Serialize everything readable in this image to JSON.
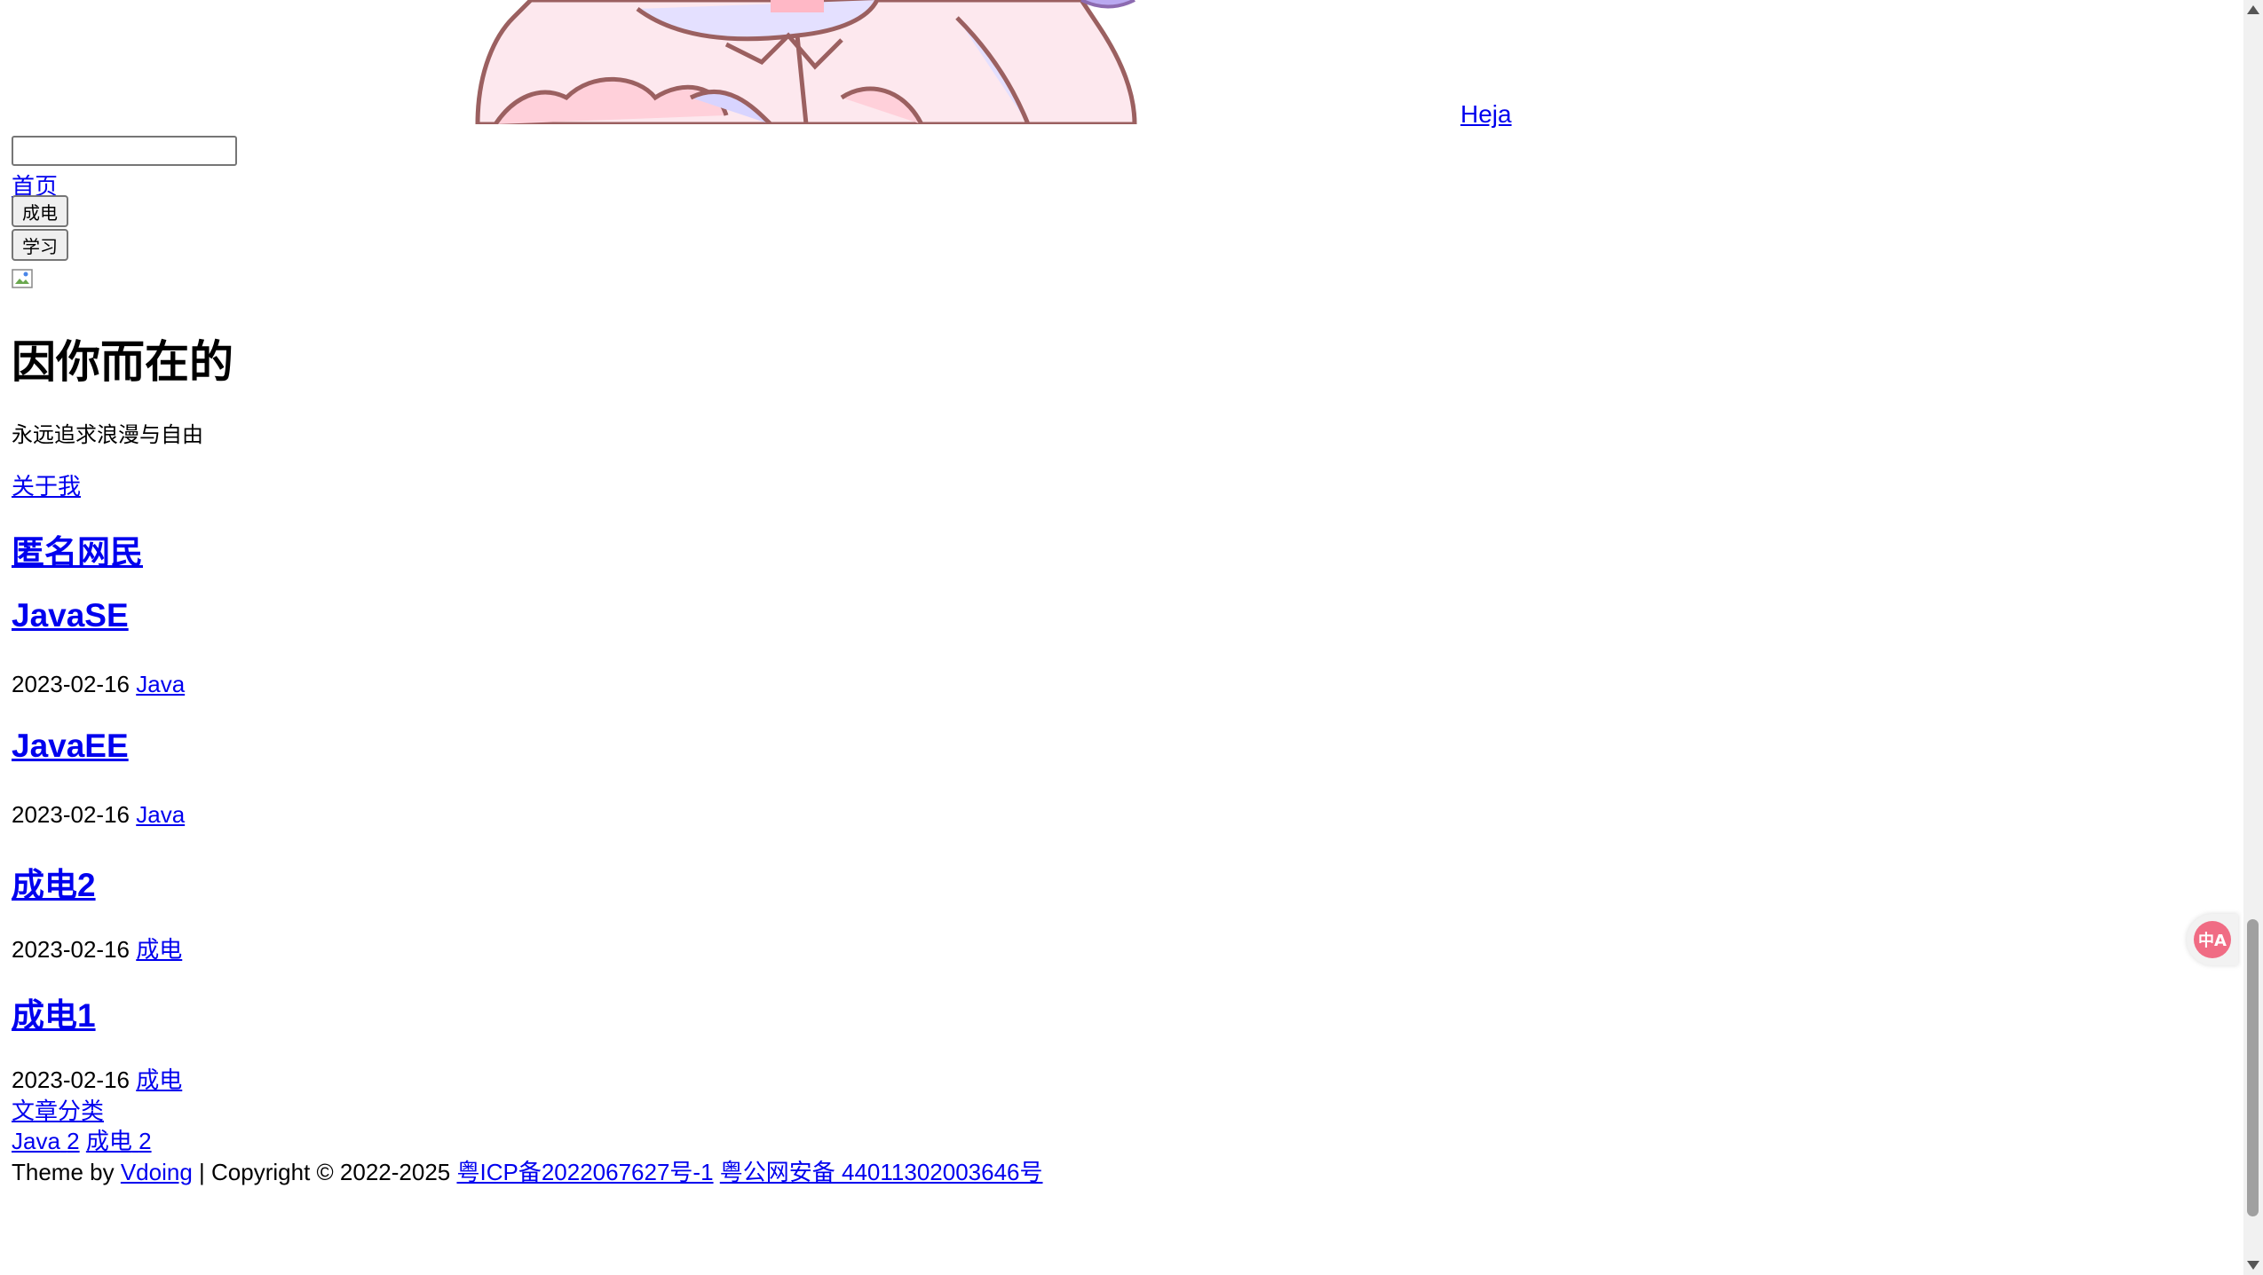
{
  "header": {
    "logo_text": " Heja",
    "search_placeholder": ""
  },
  "nav": {
    "home": "首页",
    "dropdowns": [
      "成电",
      "学习"
    ]
  },
  "sidebar": {
    "blog_title": "因你而在的",
    "blog_desc": "永远追求浪漫与自由",
    "about_link": "关于我",
    "author_name": "匿名网民"
  },
  "posts": [
    {
      "title": "JavaSE",
      "date": "2023-02-16",
      "category": "Java"
    },
    {
      "title": "JavaEE",
      "date": "2023-02-16",
      "category": "Java"
    },
    {
      "title": "成电2",
      "date": "2023-02-16",
      "category": "成电"
    },
    {
      "title": "成电1",
      "date": "2023-02-16",
      "category": "成电"
    }
  ],
  "categories": {
    "title": "文章分类",
    "items": [
      {
        "label": "Java",
        "count": "2"
      },
      {
        "label": "成电",
        "count": "2"
      }
    ]
  },
  "footer": {
    "theme_prefix": "Theme by",
    "theme_link": "Vdoing",
    "copyright": "| Copyright © 2022-2025",
    "icp": "粤ICP备2022067627号-1",
    "police": "粤公网安备 44011302003646号"
  },
  "widget": {
    "translate_icon": "translate-icon",
    "translate_glyph": "中A"
  },
  "colors": {
    "link": "#0000ee",
    "widget_accent": "#f06c84"
  }
}
